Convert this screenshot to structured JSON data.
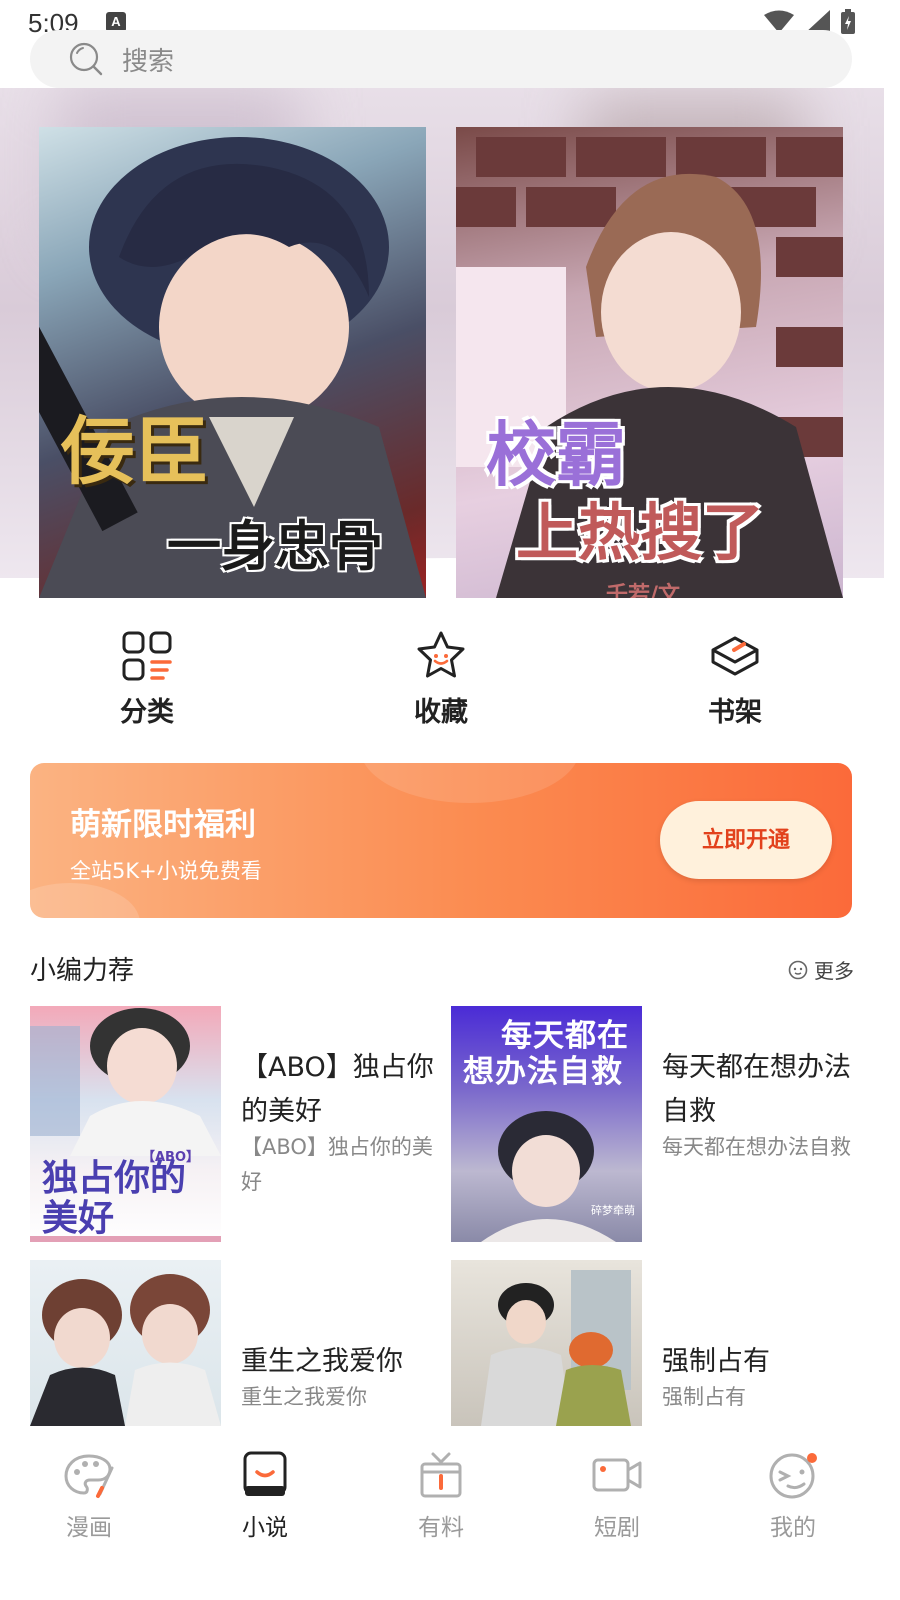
{
  "status_bar": {
    "time": "5:09"
  },
  "search": {
    "placeholder": "搜索"
  },
  "hero": {
    "covers": [
      {
        "title_line1": "佞臣",
        "title_line2": "一身忠骨"
      },
      {
        "title_line1": "校霸",
        "title_line2": "上热搜了",
        "author": "千若/文"
      }
    ]
  },
  "quick_actions": [
    {
      "label": "分类",
      "icon": "category-icon"
    },
    {
      "label": "收藏",
      "icon": "star-icon"
    },
    {
      "label": "书架",
      "icon": "bookshelf-icon"
    }
  ],
  "promo": {
    "title": "萌新限时福利",
    "subtitle": "全站5K+小说免费看",
    "button": "立即开通"
  },
  "section": {
    "title": "小编力荐",
    "more": "更多"
  },
  "books": [
    {
      "title": "【ABO】独占你的美好",
      "desc": "【ABO】独占你的美好",
      "cover_text": "独占你的美好",
      "cover_tag": "【ABO】"
    },
    {
      "title": "每天都在想办法自救",
      "desc": "每天都在想办法自救",
      "cover_text_top": "每天都在",
      "cover_text_bottom": "想办法自救",
      "cover_author": "碎梦牵萌"
    },
    {
      "title": "重生之我爱你",
      "desc": "重生之我爱你"
    },
    {
      "title": "强制占有",
      "desc": "强制占有"
    }
  ],
  "tabbar": [
    {
      "label": "漫画",
      "icon": "palette-icon",
      "active": false
    },
    {
      "label": "小说",
      "icon": "book-icon",
      "active": true
    },
    {
      "label": "有料",
      "icon": "gift-icon",
      "active": false
    },
    {
      "label": "短剧",
      "icon": "video-icon",
      "active": false
    },
    {
      "label": "我的",
      "icon": "profile-face-icon",
      "active": false
    }
  ],
  "colors": {
    "accent": "#fb6a3a",
    "promo_btn_text": "#e2411c",
    "tab_active": "#222222",
    "tab_inactive": "#9a9a9a"
  }
}
